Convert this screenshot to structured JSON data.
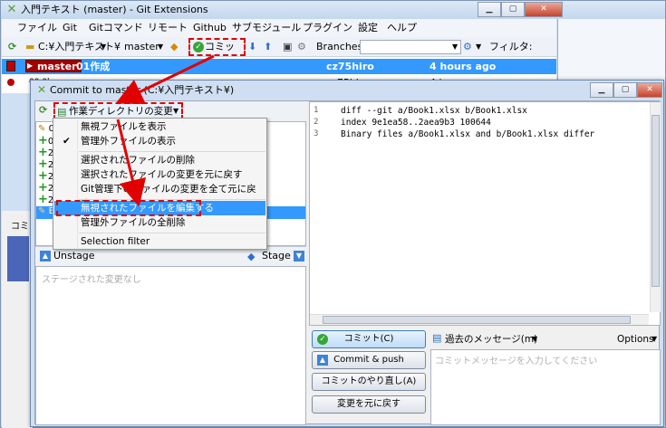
{
  "main": {
    "title": "入門テキスト (master) - Git Extensions",
    "menu": [
      "ファイル",
      "Git",
      "Gitコマンド",
      "リモート",
      "Github",
      "サブモジュール",
      "プラグイン",
      "設定",
      "ヘルプ"
    ],
    "toolbar": {
      "repo_path": "C:¥入門テキスト¥",
      "branch": "master",
      "commit_label": "コミット",
      "branches_label": "Branches:",
      "filter_label": "フィルタ:"
    },
    "revisions": [
      {
        "branch": "master",
        "message": "01作成",
        "author": "cz75hiro",
        "date": "4 hours ago"
      },
      {
        "message": "00.0l...",
        "author": "cz75hiro",
        "date": "4 hours ago"
      }
    ],
    "side_label": "コミ"
  },
  "commit_dialog": {
    "title": "Commit to master (C:¥入門テキスト¥)",
    "workdir_button": "作業ディレクトリの変更点",
    "unstaged_files": [
      {
        "mark": "pencil",
        "name": "00"
      },
      {
        "mark": "plus",
        "name": "02"
      },
      {
        "mark": "plus",
        "name": "2-"
      },
      {
        "mark": "plus",
        "name": "2-"
      },
      {
        "mark": "plus",
        "name": "2-"
      },
      {
        "mark": "plus",
        "name": "2-"
      },
      {
        "mark": "plus",
        "name": "2-"
      },
      {
        "mark": "pencil",
        "name": "Bo"
      }
    ],
    "unstage_label": "Unstage",
    "stage_label": "Stage",
    "staged_empty": "ステージされた変更なし",
    "diff": {
      "line_numbers": [
        "1",
        "2",
        "3"
      ],
      "lines": [
        "diff --git a/Book1.xlsx b/Book1.xlsx",
        "index 9e1ea58..2aea9b3 100644",
        "Binary files a/Book1.xlsx and b/Book1.xlsx differ"
      ]
    },
    "buttons": {
      "commit": "コミット(C)",
      "commit_push": "Commit & push",
      "amend": "コミットのやり直し(A)",
      "reset": "変更を元に戻す"
    },
    "prev_messages": "過去のメッセージ(m)",
    "options": "Options",
    "message_placeholder": "コミットメッセージを入力してください"
  },
  "dropdown": {
    "items": [
      {
        "label": "無視ファイルを表示",
        "checked": false
      },
      {
        "label": "管理外ファイルの表示",
        "checked": true
      },
      {
        "label": "選択されたファイルの削除",
        "checked": false
      },
      {
        "label": "選択されたファイルの変更を元に戻す",
        "checked": false
      },
      {
        "label": "Git管理下のファイルの変更を全て元に戻す",
        "checked": false
      },
      {
        "label": "無視されたファイルを編集する",
        "checked": false,
        "highlighted": true
      },
      {
        "label": "管理外ファイルの全削除",
        "checked": false
      },
      {
        "label": "Selection filter",
        "checked": false
      }
    ]
  },
  "colors": {
    "accent": "#3399ff",
    "annotation": "#e10000"
  }
}
